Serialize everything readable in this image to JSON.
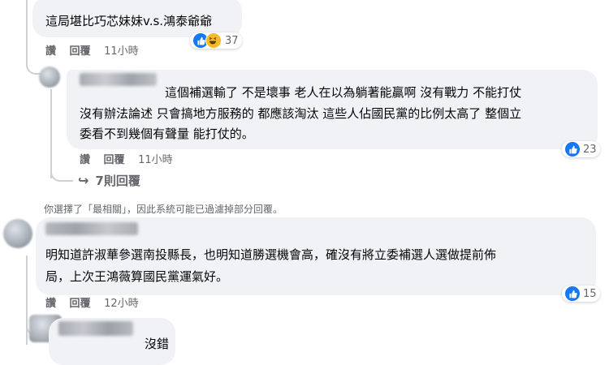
{
  "comments": [
    {
      "text": "這局堪比巧芯妹妹v.s.鴻泰爺爺",
      "actions": {
        "like": "讚",
        "reply": "回覆",
        "time": "11小時"
      },
      "reactions": {
        "icons": [
          "like-icon",
          "haha-icon"
        ],
        "count": "37"
      }
    },
    {
      "text_lines": [
        "這個補選輸了 不是壞事 老人在以為躺著能贏啊 沒有戰力 不能打仗",
        "沒有辦法論述 只會搞地方服務的 都應該淘汰 這些人佔國民黨的比例太高了 整個立",
        "委看不到幾個有聲量 能打仗的。"
      ],
      "actions": {
        "like": "讚",
        "reply": "回覆",
        "time": "11小時"
      },
      "reactions": {
        "icons": [
          "like-icon"
        ],
        "count": "23"
      },
      "replies_link": "7則回覆"
    },
    {
      "text_lines": [
        "明知道許淑華參選南投縣長，也明知道勝選機會高，確沒有將立委補選人選做提前佈",
        "局，上次王鴻薇算國民黨運氣好。"
      ],
      "actions": {
        "like": "讚",
        "reply": "回覆",
        "time": "12小時"
      },
      "reactions": {
        "icons": [
          "like-icon"
        ],
        "count": "15"
      }
    },
    {
      "text": "沒錯"
    }
  ],
  "filter_notice": "你選擇了「最相關」，因此系統可能已過濾掉部分回覆。",
  "colors": {
    "bubble": "#f0f2f5",
    "secondary_text": "#65676b",
    "like_blue": "#1877f2",
    "haha_yellow": "#f7b928"
  }
}
